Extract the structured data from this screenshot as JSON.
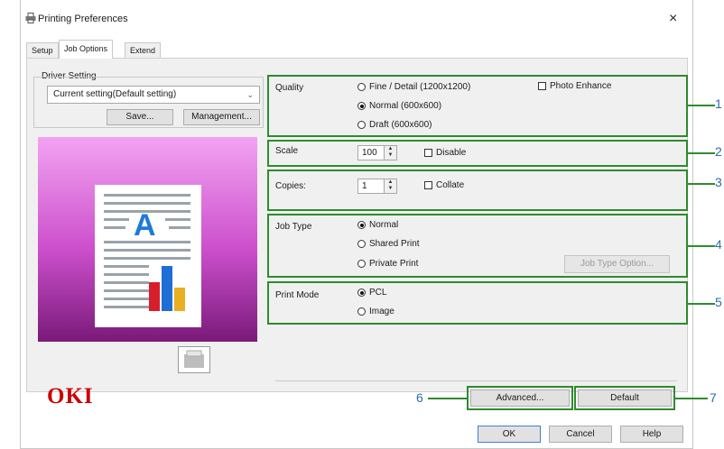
{
  "window": {
    "title": "Printing Preferences",
    "close": "×"
  },
  "tabs": [
    "Setup",
    "Job Options",
    "Extend"
  ],
  "driver_setting": {
    "label": "Driver Setting",
    "current": "Current setting(Default setting)",
    "save": "Save...",
    "management": "Management..."
  },
  "quality": {
    "label": "Quality",
    "options": [
      "Fine / Detail (1200x1200)",
      "Normal (600x600)",
      "Draft (600x600)"
    ],
    "selected": "Normal (600x600)",
    "photo_enhance": "Photo Enhance"
  },
  "scale": {
    "label": "Scale",
    "value": "100",
    "disable": "Disable"
  },
  "copies": {
    "label": "Copies:",
    "value": "1",
    "collate": "Collate"
  },
  "job_type": {
    "label": "Job Type",
    "options": [
      "Normal",
      "Shared Print",
      "Private Print"
    ],
    "selected": "Normal",
    "option_button": "Job Type Option..."
  },
  "print_mode": {
    "label": "Print Mode",
    "options": [
      "PCL",
      "Image"
    ],
    "selected": "PCL"
  },
  "brand": "OKI",
  "buttons": {
    "advanced": "Advanced...",
    "default": "Default",
    "ok": "OK",
    "cancel": "Cancel",
    "help": "Help"
  },
  "callouts": [
    "1",
    "2",
    "3",
    "4",
    "5",
    "6",
    "7"
  ],
  "colors": {
    "highlight": "#2e8b2e",
    "callout_text": "#2a6ea8",
    "brand": "#cc0000"
  }
}
